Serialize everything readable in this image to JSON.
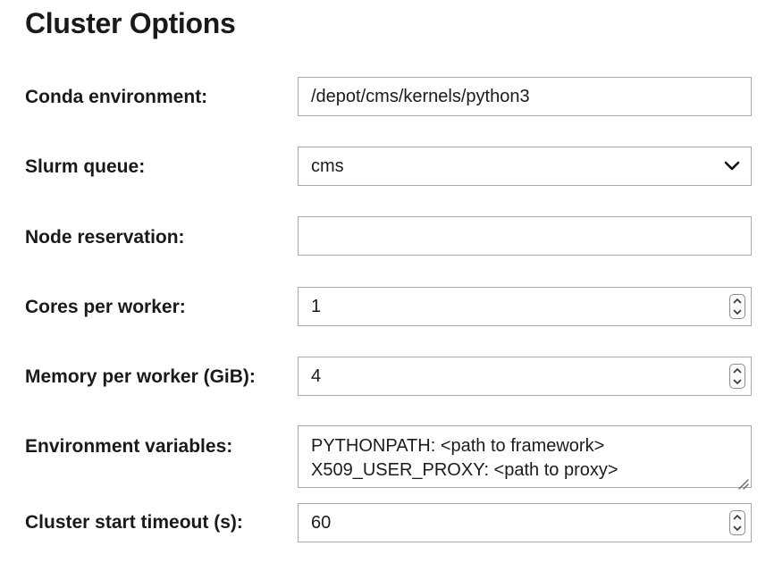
{
  "form": {
    "title": "Cluster Options",
    "conda_environment": {
      "label": "Conda environment:",
      "value": "/depot/cms/kernels/python3"
    },
    "slurm_queue": {
      "label": "Slurm queue:",
      "selected": "cms"
    },
    "node_reservation": {
      "label": "Node reservation:",
      "value": ""
    },
    "cores_per_worker": {
      "label": "Cores per worker:",
      "value": "1"
    },
    "memory_per_worker": {
      "label": "Memory per worker (GiB):",
      "value": "4"
    },
    "environment_variables": {
      "label": "Environment variables:",
      "lines": [
        "PYTHONPATH: <path to framework>",
        "X509_USER_PROXY: <path to proxy>"
      ]
    },
    "cluster_start_timeout": {
      "label": "Cluster start timeout (s):",
      "value": "60"
    }
  },
  "icons": {
    "select_chevron": "chevron-down-icon",
    "spinner": "stepper-arrows-icon",
    "resize": "resize-handle-icon"
  },
  "colors": {
    "border": "#a9a9a9",
    "text": "#1b1b1b"
  }
}
